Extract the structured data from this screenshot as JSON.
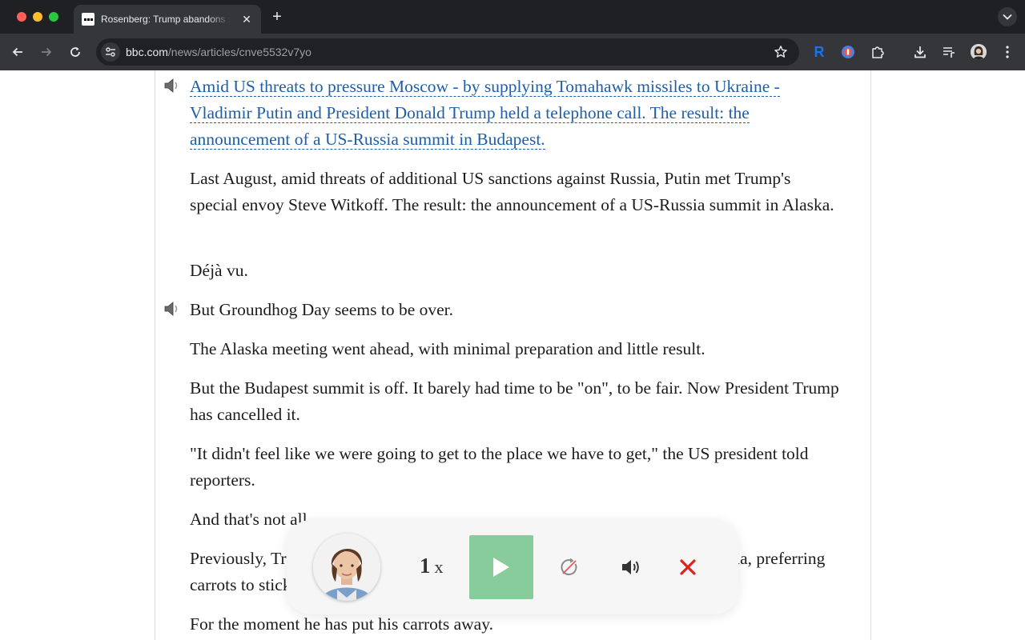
{
  "browser": {
    "tab": {
      "title": "Rosenberg: Trump abandons summit with Putin"
    },
    "address_bar": {
      "domain": "bbc.com",
      "path": "/news/articles/cnve5532v7yo"
    },
    "extensions": {
      "r_label": "R"
    }
  },
  "article": {
    "paragraphs": [
      {
        "text": "Amid US threats to pressure Moscow - by supplying Tomahawk missiles to Ukraine - Vladimir Putin and President Donald Trump held a telephone call. The result: the announcement of a US-Russia summit in Budapest.",
        "is_link": true,
        "has_speaker": true
      },
      {
        "text": "Last August, amid threats of additional US sanctions against Russia, Putin met Trump's special envoy Steve Witkoff. The result: the announcement of a US-Russia summit in Alaska."
      },
      {
        "text": "Déjà vu."
      },
      {
        "text": "But Groundhog Day seems to be over.",
        "has_speaker": true
      },
      {
        "text": "The Alaska meeting went ahead, with minimal preparation and little result."
      },
      {
        "text": "But the Budapest summit is off. It barely had time to be \"on\", to be fair. Now President Trump has cancelled it."
      },
      {
        "text": "\"It didn't feel like we were going to get to the place we have to get,\" the US president told reporters."
      },
      {
        "text": "And that's not all."
      },
      {
        "text": "Previously, Trump had appeared reluctant to apply significant pressure on Russia, preferring carrots to sticks."
      },
      {
        "text": "For the moment he has put his carrots away."
      }
    ]
  },
  "player": {
    "speed_value": "1",
    "speed_unit": "x",
    "icons": {
      "avatar": "narrator-avatar",
      "play": "play-icon",
      "repeat": "repeat-disabled-icon",
      "volume": "volume-icon",
      "close": "close-icon"
    },
    "colors": {
      "play_button": "#88cc9c",
      "close": "#e02020"
    }
  }
}
